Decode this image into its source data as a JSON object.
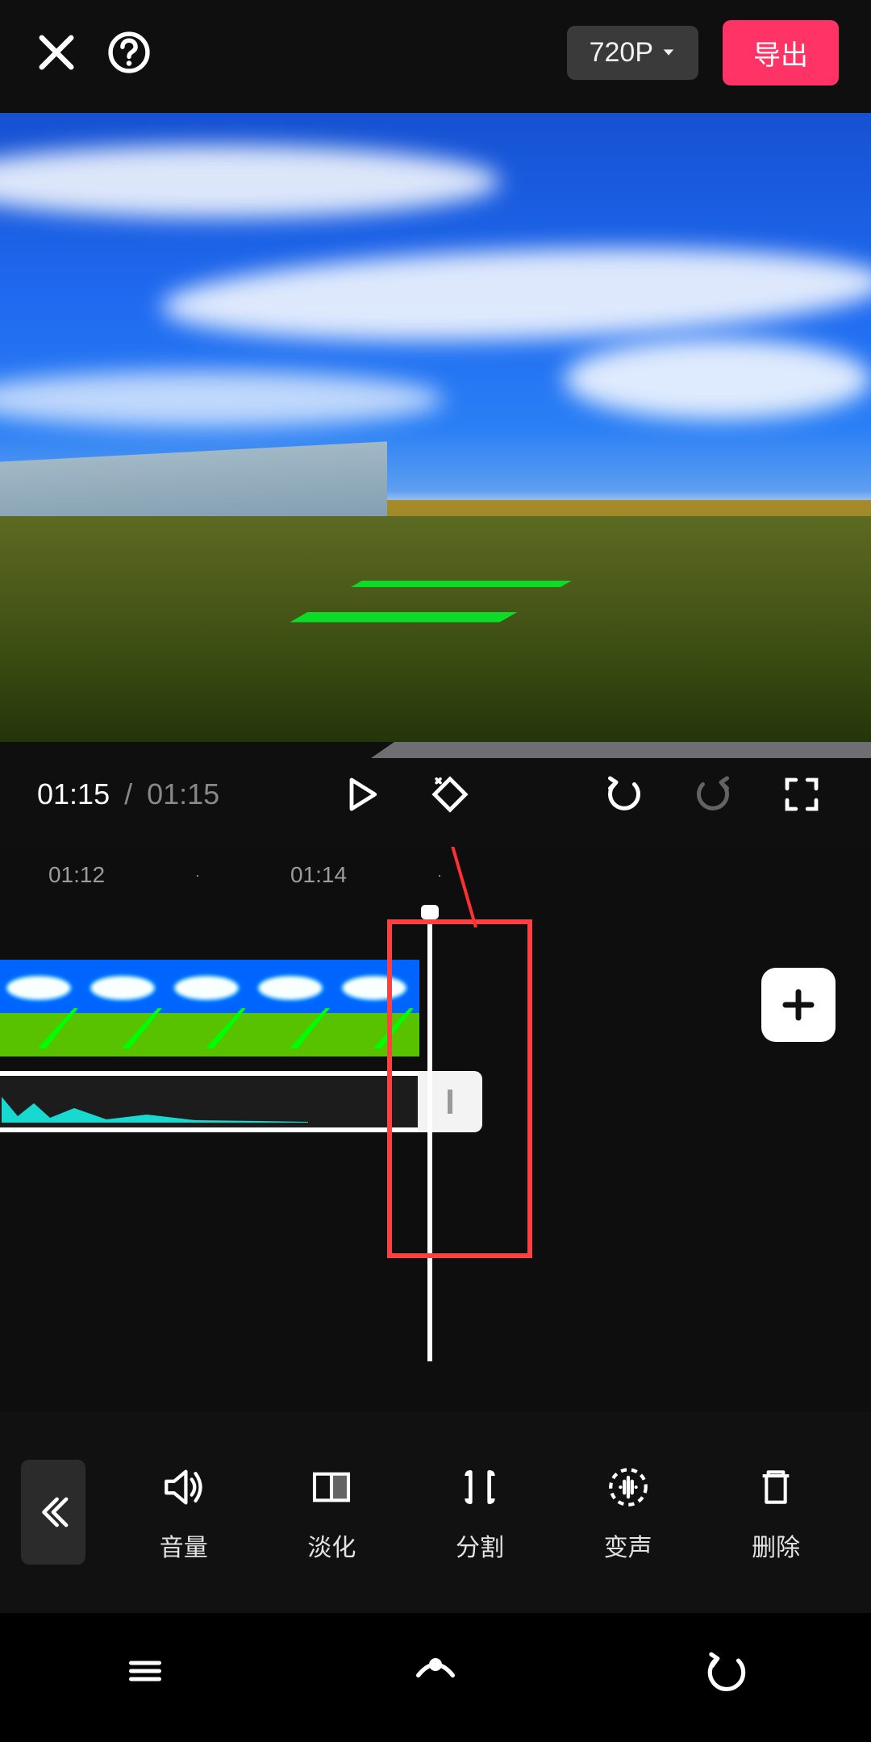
{
  "header": {
    "resolution_label": "720P",
    "export_label": "导出"
  },
  "playback": {
    "current_time": "01:15",
    "total_time": "01:15"
  },
  "ruler": {
    "t1": "01:12",
    "t2": "01:14"
  },
  "toolbar": {
    "volume": "音量",
    "fade": "淡化",
    "split": "分割",
    "voice": "变声",
    "delete": "删除"
  }
}
